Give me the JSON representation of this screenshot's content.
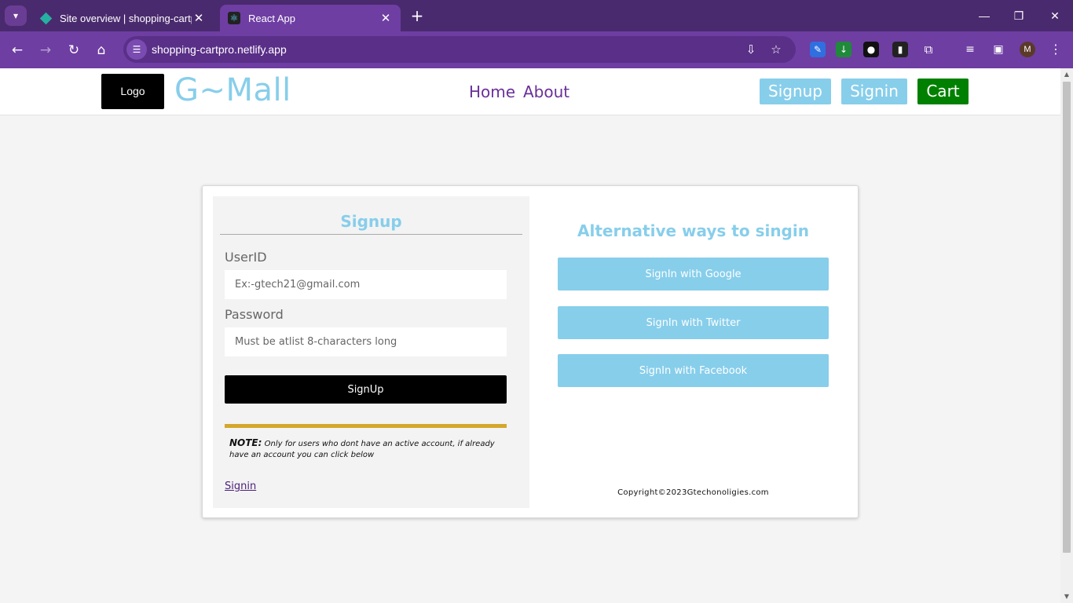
{
  "browser": {
    "tabs": [
      {
        "title": "Site overview | shopping-cartpro",
        "active": false,
        "favicon": "netlify-diamond-icon"
      },
      {
        "title": "React App",
        "active": true,
        "favicon": "react-icon"
      }
    ],
    "url": "shopping-cartpro.netlify.app",
    "profile_initial": "M"
  },
  "header": {
    "logo": "Logo",
    "brand": "G~Mall",
    "nav": [
      "Home",
      "About"
    ],
    "signup": "Signup",
    "signin": "Signin",
    "cart": "Cart",
    "colors": {
      "accent": "#87ceeb",
      "cart": "#008000",
      "nav": "#6a2f9a"
    }
  },
  "signup_form": {
    "title": "Signup",
    "userid_label": "UserID",
    "userid_placeholder": "Ex:-gtech21@gmail.com",
    "password_label": "Password",
    "password_placeholder": "Must be atlist 8-characters long",
    "submit": "SignUp",
    "note_label": "NOTE:",
    "note_text": "Only for users who dont have an active account, if already have an account you can click below",
    "signin_link": "Signin"
  },
  "alternatives": {
    "title": "Alternative ways to singin",
    "google": "SignIn with Google",
    "twitter": "SignIn with Twitter",
    "facebook": "SignIn with Facebook",
    "copyright": "Copyright©2023Gtechonoligies.com"
  }
}
